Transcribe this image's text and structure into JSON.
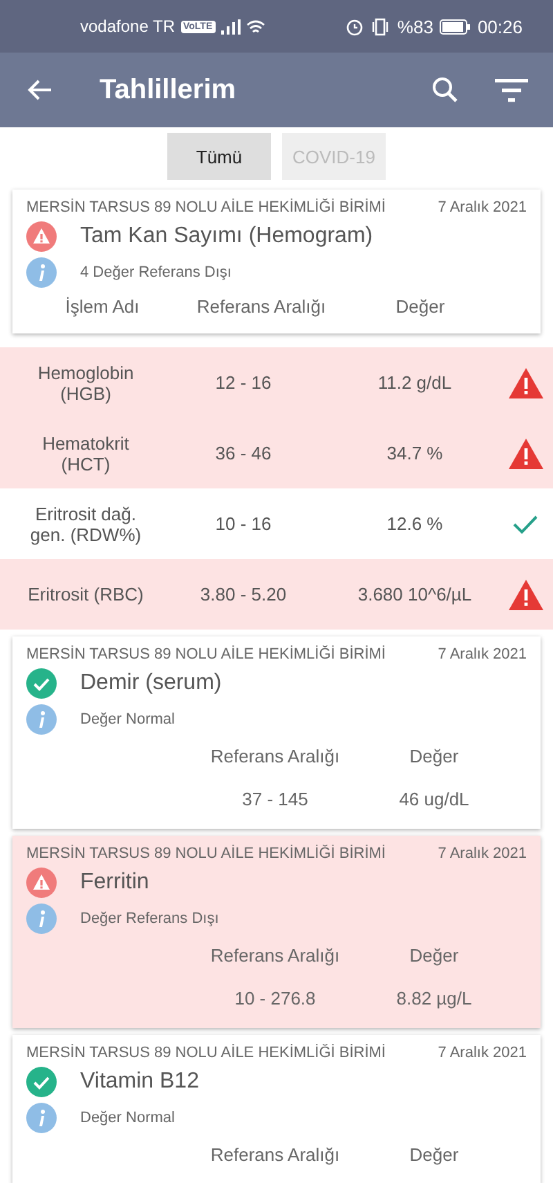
{
  "status_bar": {
    "carrier": "vodafone TR",
    "network_badge": "VoLTE",
    "battery_percent": "%83",
    "time": "00:26"
  },
  "app_bar": {
    "title": "Tahlillerim"
  },
  "filters": [
    {
      "label": "Tümü",
      "selected": true
    },
    {
      "label": "COVID-19",
      "selected": false
    }
  ],
  "results": [
    {
      "kind": "panel",
      "facility": "MERSİN TARSUS 89 NOLU AİLE HEKİMLİĞİ BİRİMİ",
      "date": "7 Aralık 2021",
      "name": "Tam Kan Sayımı (Hemogram)",
      "abnormal": true,
      "summary": "4 Değer Referans Dışı",
      "columns": [
        "İşlem Adı",
        "Referans Aralığı",
        "Değer"
      ],
      "rows": [
        {
          "name": "Hemoglobin (HGB)",
          "range": "12 - 16",
          "value": "11.2 g/dL",
          "abnormal": true
        },
        {
          "name": "Hematokrit (HCT)",
          "range": "36 - 46",
          "value": "34.7 %",
          "abnormal": true
        },
        {
          "name": "Eritrosit dağ. gen. (RDW%)",
          "range": "10 - 16",
          "value": "12.6 %",
          "abnormal": false
        },
        {
          "name": "Eritrosit (RBC)",
          "range": "3.80 - 5.20",
          "value": "3.680 10^6/µL",
          "abnormal": true
        }
      ]
    },
    {
      "kind": "single",
      "facility": "MERSİN TARSUS 89 NOLU AİLE HEKİMLİĞİ BİRİMİ",
      "date": "7 Aralık 2021",
      "name": "Demir (serum)",
      "abnormal": false,
      "summary": "Değer Normal",
      "columns": [
        "Referans Aralığı",
        "Değer"
      ],
      "range": "37 - 145",
      "value": "46 ug/dL"
    },
    {
      "kind": "single",
      "facility": "MERSİN TARSUS 89 NOLU AİLE HEKİMLİĞİ BİRİMİ",
      "date": "7 Aralık 2021",
      "name": "Ferritin",
      "abnormal": true,
      "summary": "Değer Referans Dışı",
      "columns": [
        "Referans Aralığı",
        "Değer"
      ],
      "range": "10 - 276.8",
      "value": "8.82 µg/L"
    },
    {
      "kind": "single",
      "facility": "MERSİN TARSUS 89 NOLU AİLE HEKİMLİĞİ BİRİMİ",
      "date": "7 Aralık 2021",
      "name": "Vitamin B12",
      "abnormal": false,
      "summary": "Değer Normal",
      "columns": [
        "Referans Aralığı",
        "Değer"
      ]
    }
  ]
}
